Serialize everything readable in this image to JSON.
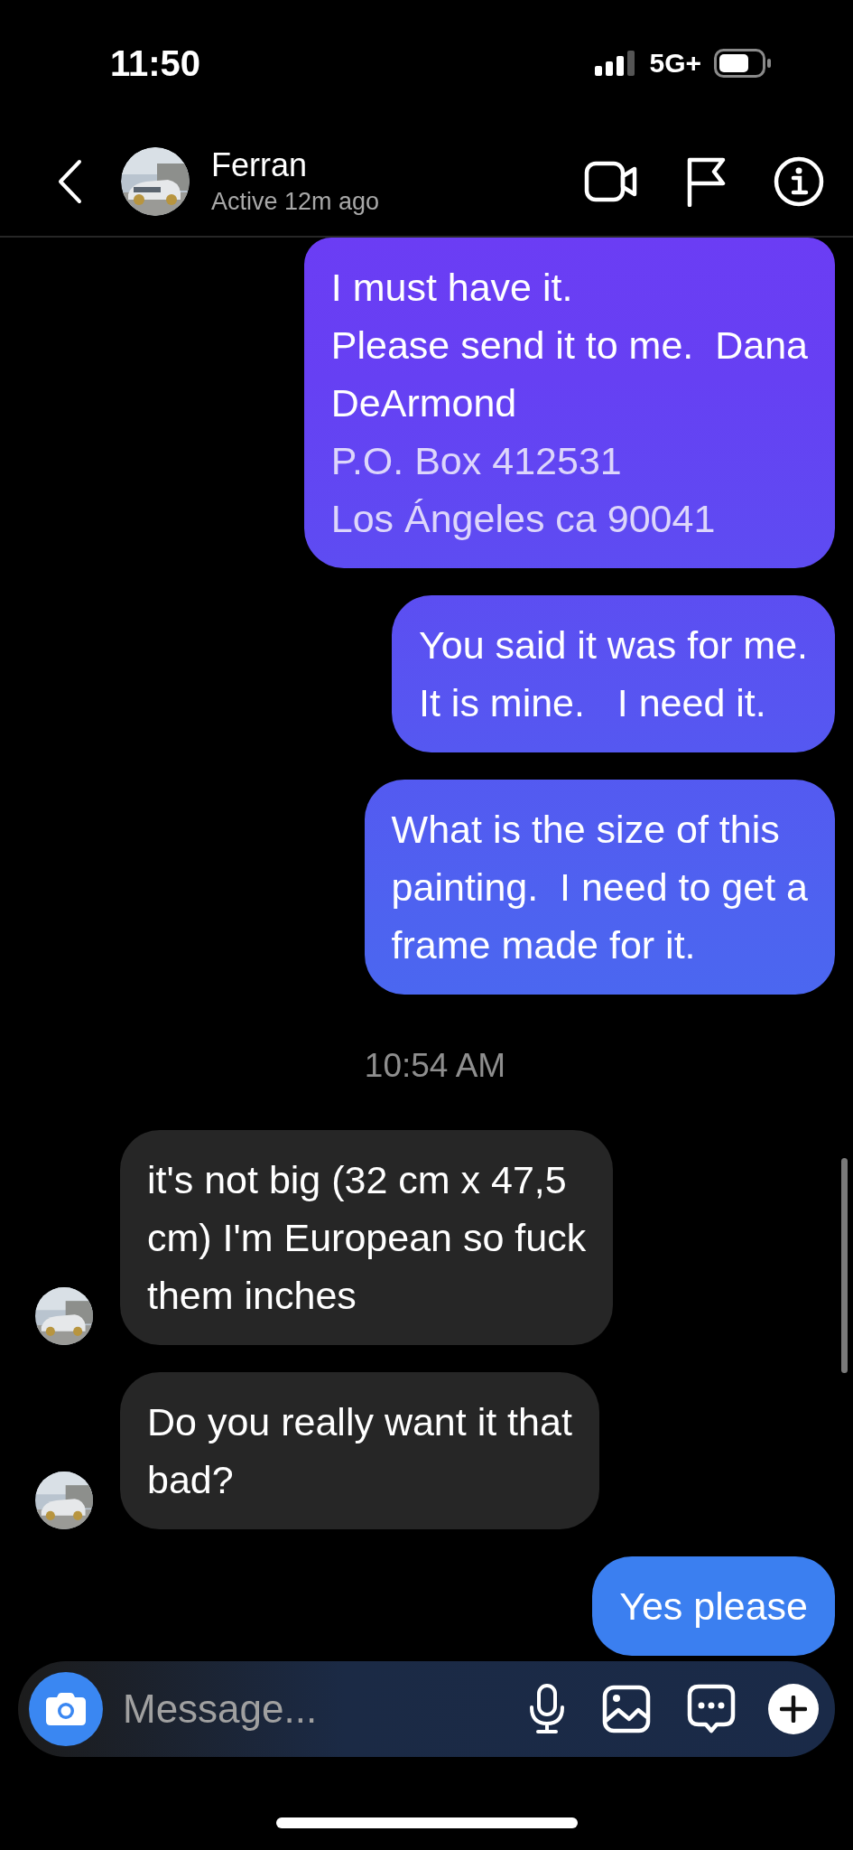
{
  "status_bar": {
    "time": "11:50",
    "network": "5G+"
  },
  "header": {
    "name": "Ferran",
    "status": "Active 12m ago"
  },
  "messages": [
    {
      "kind": "sent",
      "text": "I must have it.\nPlease send it to me.  Dana\nDeArmond",
      "address_lines": [
        "P.O. Box 412531",
        "Los Ángeles ca 90041"
      ]
    },
    {
      "kind": "sent",
      "text": "You said it was for me.\nIt is mine.   I need it."
    },
    {
      "kind": "sent",
      "text": "What is the size of this\npainting.  I need to get a\nframe made for it."
    },
    {
      "kind": "timestamp",
      "text": "10:54 AM"
    },
    {
      "kind": "received",
      "text": "it's not big (32 cm x 47,5\ncm) I'm European so fuck\nthem inches"
    },
    {
      "kind": "received",
      "text": "Do you really want it that\nbad?"
    },
    {
      "kind": "sent",
      "text": "Yes please"
    }
  ],
  "composer": {
    "placeholder": "Message..."
  }
}
